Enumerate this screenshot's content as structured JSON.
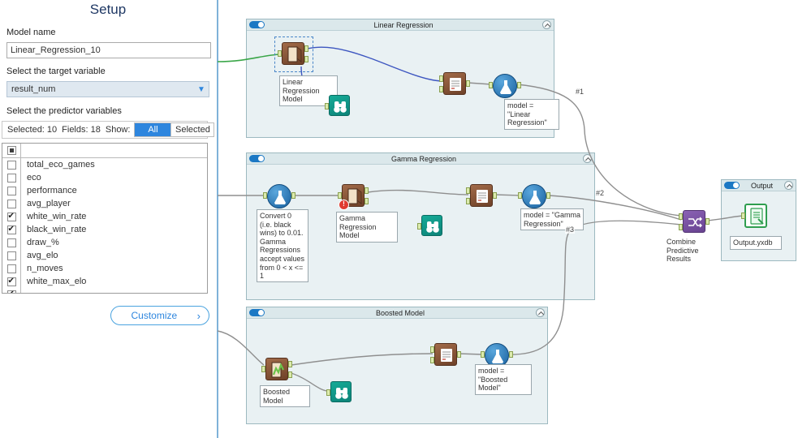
{
  "setup": {
    "title": "Setup",
    "model_name_label": "Model name",
    "model_name_value": "Linear_Regression_10",
    "target_label": "Select the target variable",
    "target_value": "result_num",
    "predictors_label": "Select the predictor variables",
    "selected_count": "Selected: 10",
    "fields_count": "Fields: 18",
    "show_label": "Show:",
    "show_options": [
      "All",
      "Selected"
    ],
    "fields": [
      {
        "name": "total_eco_games",
        "checked": false
      },
      {
        "name": "eco",
        "checked": false
      },
      {
        "name": "performance",
        "checked": false
      },
      {
        "name": "avg_player",
        "checked": false
      },
      {
        "name": "white_win_rate",
        "checked": true
      },
      {
        "name": "black_win_rate",
        "checked": true
      },
      {
        "name": "draw_%",
        "checked": false
      },
      {
        "name": "avg_elo",
        "checked": false
      },
      {
        "name": "n_moves",
        "checked": false
      },
      {
        "name": "white_max_elo",
        "checked": true
      },
      {
        "name": "",
        "checked": true
      }
    ],
    "customize_label": "Customize",
    "customize_chevron": "›"
  },
  "canvas": {
    "containers": {
      "linear": {
        "title": "Linear Regression"
      },
      "gamma": {
        "title": "Gamma Regression"
      },
      "boosted": {
        "title": "Boosted Model"
      },
      "output": {
        "title": "Output"
      }
    },
    "annotations": {
      "linear_model_label": "Linear Regression Model",
      "linear_comment": "model = \"Linear Regression\"",
      "gamma_note": "Convert 0 (i.e. black wins) to 0.01. Gamma Regressions accept values from 0 < x <= 1",
      "gamma_model_label": "Gamma Regression Model",
      "gamma_comment": "model = \"Gamma Regression\"",
      "boosted_model_label": "Boosted Model",
      "boosted_comment": "model = \"Boosted Model\"",
      "combine_label": "Combine Predictive Results",
      "output_file_label": "Output.yxdb",
      "error_badge": "!"
    },
    "wire_labels": {
      "w1": "#1",
      "w2": "#2",
      "w3": "#3"
    },
    "colors": {
      "wire_gray": "#8f8f8f",
      "wire_blue": "#3d56c0",
      "wire_green": "#3aa648",
      "accent_blue": "#2e86de"
    }
  }
}
